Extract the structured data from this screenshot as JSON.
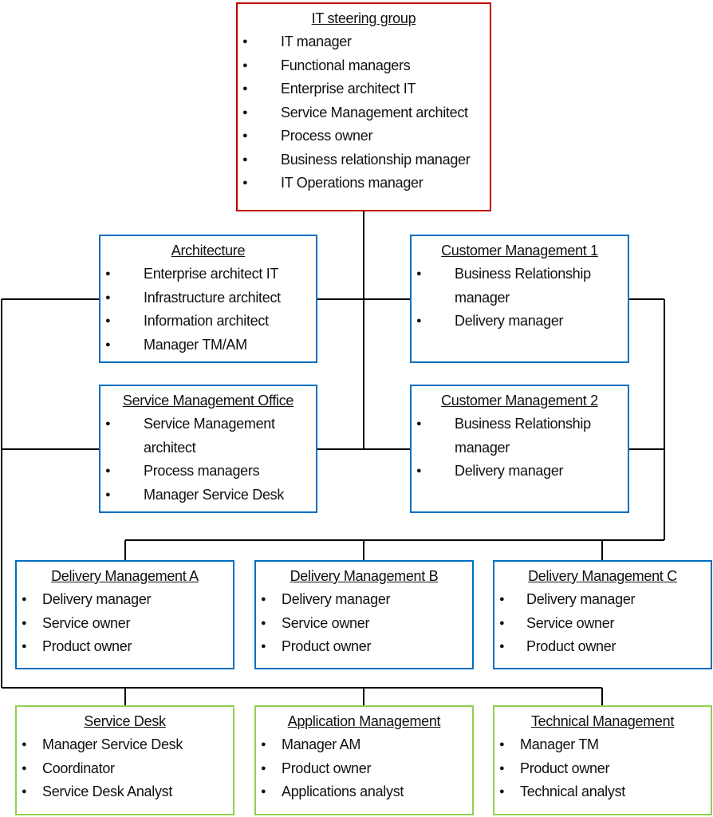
{
  "colors": {
    "steering": "#c00000",
    "management": "#0070c0",
    "operations": "#92d050",
    "connector": "#000000"
  },
  "boxes": [
    {
      "id": "it-steering-group",
      "title": "IT steering group",
      "color": "steering",
      "items": [
        "IT manager",
        "Functional managers",
        "Enterprise architect IT",
        "Service Management architect",
        "Process owner",
        "Business relationship manager",
        "IT Operations manager"
      ]
    },
    {
      "id": "architecture",
      "title": "Architecture",
      "color": "management",
      "items": [
        "Enterprise architect IT",
        "Infrastructure architect",
        "Information architect",
        "Manager TM/AM"
      ]
    },
    {
      "id": "customer-management-1",
      "title": "Customer Management 1",
      "color": "management",
      "items": [
        "Business Relationship manager",
        "Delivery manager"
      ]
    },
    {
      "id": "service-management-office",
      "title": "Service Management Office",
      "color": "management",
      "items": [
        "Service Management architect",
        "Process managers",
        "Manager Service Desk"
      ]
    },
    {
      "id": "customer-management-2",
      "title": "Customer Management 2",
      "color": "management",
      "items": [
        "Business Relationship manager",
        "Delivery manager"
      ]
    },
    {
      "id": "delivery-management-a",
      "title": "Delivery Management A",
      "color": "management",
      "items": [
        "Delivery manager",
        "Service owner",
        "Product owner"
      ]
    },
    {
      "id": "delivery-management-b",
      "title": "Delivery Management B",
      "color": "management",
      "items": [
        "Delivery manager",
        "Service owner",
        "Product owner"
      ]
    },
    {
      "id": "delivery-management-c",
      "title": "Delivery Management C",
      "color": "management",
      "items": [
        "Delivery manager",
        "Service owner",
        "Product owner"
      ]
    },
    {
      "id": "service-desk",
      "title": "Service Desk",
      "color": "operations",
      "items": [
        "Manager Service Desk",
        "Coordinator",
        "Service Desk Analyst"
      ]
    },
    {
      "id": "application-management",
      "title": "Application Management",
      "color": "operations",
      "items": [
        "Manager AM",
        "Product owner",
        "Applications analyst"
      ]
    },
    {
      "id": "technical-management",
      "title": "Technical Management",
      "color": "operations",
      "items": [
        "Manager TM",
        "Product owner",
        "Technical analyst"
      ]
    }
  ]
}
